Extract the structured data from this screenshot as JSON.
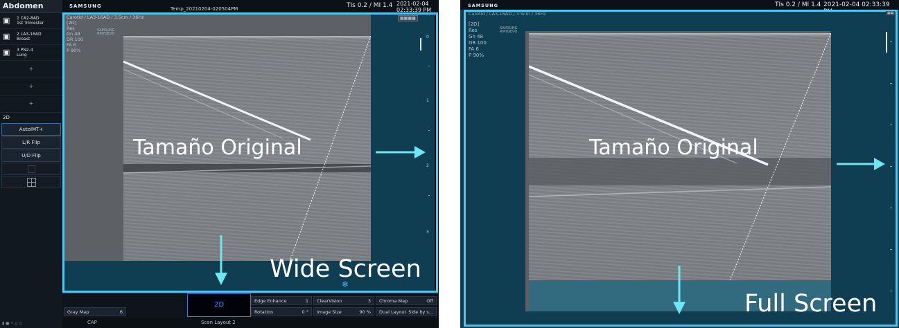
{
  "left": {
    "sidebar": {
      "title": "Abdomen",
      "probes": [
        {
          "line1": "1 CA2-8AD",
          "line2": "1st Trimester"
        },
        {
          "line1": "2 LA3-16AD",
          "line2": "Breast"
        },
        {
          "line1": "3 PN2-4",
          "line2": "Lung"
        }
      ],
      "plus": "+",
      "mode": "2D",
      "buttons": [
        "AutoIMT+",
        "L/R Flip",
        "U/D Flip"
      ]
    },
    "topbar": {
      "brand": "SAMSUNG",
      "temp_name": "Temp_20210204-020504PM",
      "tis": "TIs 0.2",
      "mi": "/ MI 1.4",
      "date": "2021-02-04",
      "time": "02:33:39 PM"
    },
    "image": {
      "probe_line": "Carotid / LA3-16AD / 3.5cm / 36Hz",
      "mode": "[2D]",
      "params": [
        "Res",
        "Gn   48",
        "DR   100",
        "FA   6",
        "P    90%"
      ],
      "logo_line1": "SAMSUNG",
      "logo_line2": "RM7DEVO",
      "scale": [
        "0",
        "1",
        "2",
        "3"
      ]
    },
    "overlay": {
      "original": "Tamaño Original",
      "wide": "Wide Screen"
    },
    "panel": {
      "gray_map": {
        "label": "Gray Map",
        "value": "6"
      },
      "mode_2d": "2D",
      "edge_enhance": {
        "label": "Edge Enhance",
        "value": "1"
      },
      "rotation": {
        "label": "Rotation",
        "value": "0 °"
      },
      "clearvision": {
        "label": "ClearVision",
        "value": "3"
      },
      "image_size": {
        "label": "Image Size",
        "value": "90 %"
      },
      "chroma_map": {
        "label": "Chroma Map",
        "value": "Off"
      },
      "dual_layout": {
        "label": "Dual Layout",
        "value": "Side by s..."
      },
      "cap": "CAP",
      "layout": "Scan Layout 2"
    }
  },
  "right": {
    "topbar": {
      "brand": "SAMSUNG",
      "tis": "TIs 0.2",
      "mi": "/ MI 1.4",
      "datetime": "2021-02-04  02:33:39 PM"
    },
    "image": {
      "probe_line": "Carotid / LA3-16AD / 3.5cm / 36Hz",
      "mode": "[2D]",
      "params": [
        "Res",
        "Gn   48",
        "DR   100",
        "FA   6",
        "P    90%"
      ],
      "logo_line1": "SAMSUNG",
      "logo_line2": "RM7DEVO"
    },
    "overlay": {
      "original": "Tamaño Original",
      "full": "Full Screen"
    }
  },
  "colors": {
    "frame": "#4fc6ef",
    "teal": "#0f3d52",
    "arrow": "#6fe6f2"
  }
}
